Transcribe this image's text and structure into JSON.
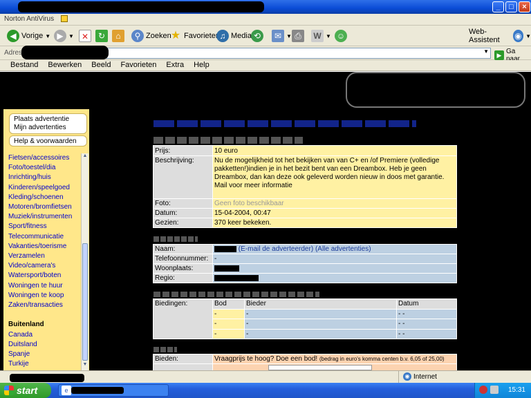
{
  "browser": {
    "norton_label": "Norton AntiVirus",
    "toolbar": {
      "back": "Vorige",
      "search": "Zoeken",
      "favorites": "Favorieten",
      "media": "Media",
      "web_assistant": "Web-Assistent"
    },
    "address_label": "Adres",
    "go_label": "Ga naar",
    "menu": [
      "Bestand",
      "Bewerken",
      "Beeld",
      "Favorieten",
      "Extra",
      "Help"
    ]
  },
  "sidebar": {
    "place_ad": "Plaats advertentie",
    "my_ads": "Mijn advertenties",
    "help": "Help & voorwaarden",
    "categories": [
      "Fietsen/accessoires",
      "Foto/toestel/dia",
      "Inrichting/huis",
      "Kinderen/speelgoed",
      "Kleding/schoenen",
      "Motoren/bromfietsen",
      "Muziek/instrumenten",
      "Sport/fitness",
      "Telecommunicatie",
      "Vakanties/toerisme",
      "Verzamelen",
      "Video/camera's",
      "Watersport/boten",
      "Woningen te huur",
      "Woningen te koop",
      "Zaken/transacties"
    ],
    "abroad_title": "Buitenland",
    "abroad": [
      "Canada",
      "Duitsland",
      "Spanje",
      "Turkije"
    ]
  },
  "listing": {
    "labels": {
      "price": "Prijs:",
      "description": "Beschrijving:",
      "photo": "Foto:",
      "date": "Datum:",
      "views": "Gezien:"
    },
    "price": "10 euro",
    "description": "Nu de mogelijkheid tot het bekijken van van C+ en /of Premiere (volledige pakketten!)indien je in het bezit bent van een Dreambox. Heb je geen Dreambox, dan kan deze ook geleverd worden nieuw in doos met garantie.",
    "description_line2": "Mail voor meer informatie",
    "photo": "Geen foto beschikbaar",
    "date": "15-04-2004, 00:47",
    "views": "370 keer bekeken."
  },
  "advertiser": {
    "labels": {
      "name": "Naam:",
      "phone": "Telefoonnummer:",
      "city": "Woonplaats:",
      "region": "Regio:"
    },
    "email_link": "(E-mail de adverteerder)",
    "all_ads_link": "(Alle advertenties)",
    "phone": "-"
  },
  "bids": {
    "label": "Biedingen:",
    "headers": [
      "Bod",
      "Bieder",
      "Datum"
    ],
    "rows": [
      [
        "-",
        "-",
        "- -"
      ],
      [
        "-",
        "-",
        "- -"
      ],
      [
        "-",
        "-",
        "- -"
      ]
    ]
  },
  "bid_form": {
    "label": "Bieden:",
    "prompt": "Vraagprijs te hoog? Doe een bod!",
    "hint": "(bedrag in euro's komma centen b.v. 6,05 of 25,00)"
  },
  "status": {
    "zone": "Internet"
  },
  "taskbar": {
    "start": "start",
    "clock": "15:31"
  },
  "colors": {
    "sidebar_bg": "#ffe78a",
    "yellow_cell": "#fff1a3",
    "blue_cell": "#bdd0e2",
    "label_cell": "#dddddd",
    "link": "#0000cc"
  }
}
